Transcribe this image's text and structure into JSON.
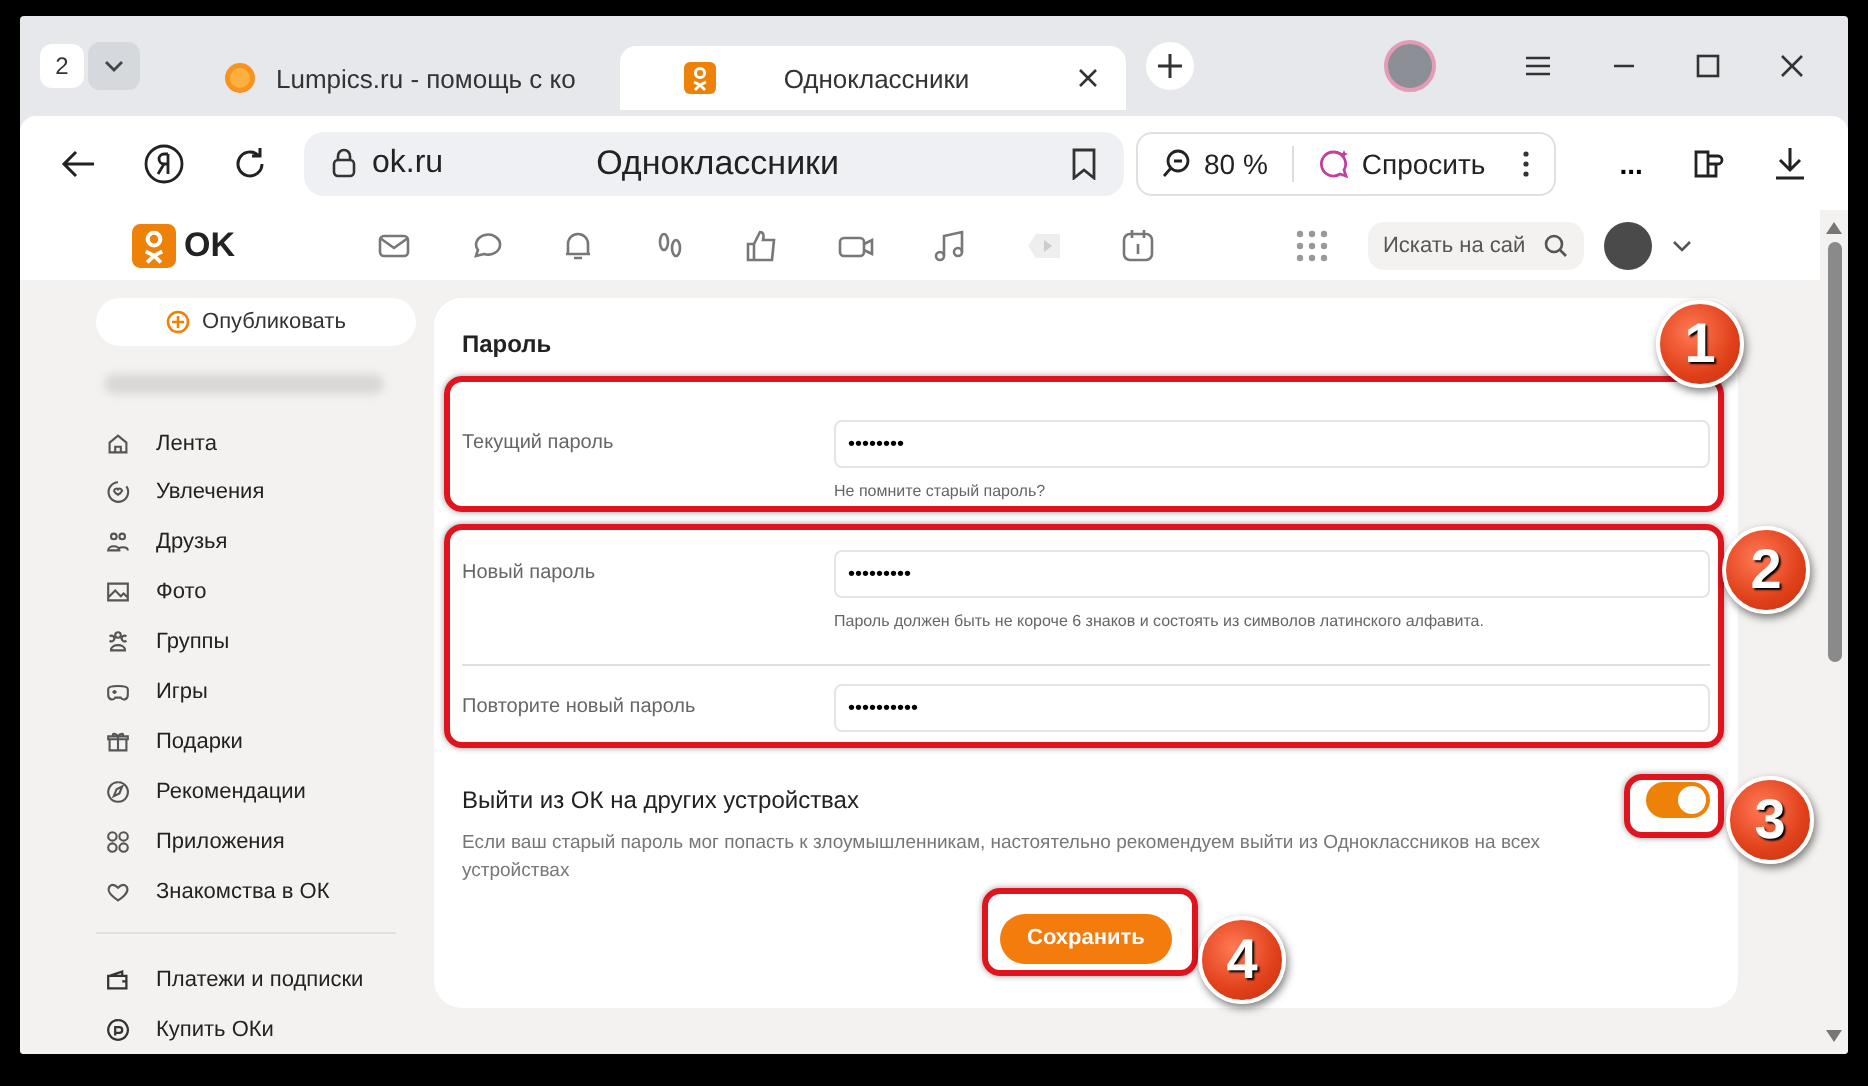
{
  "browser": {
    "tab_count": "2",
    "tabs": [
      {
        "title": "Lumpics.ru - помощь с ко",
        "selected": false
      },
      {
        "title": "Одноклассники",
        "selected": true
      }
    ],
    "url": "ok.ru",
    "page_title": "Одноклассники",
    "zoom": "80 %",
    "ask": "Спросить",
    "more": "..."
  },
  "site_header": {
    "logo": "OK",
    "search": {
      "placeholder": "Искать на сай"
    }
  },
  "sidebar": {
    "publish": "Опубликовать",
    "items": [
      {
        "label": "Лента"
      },
      {
        "label": "Увлечения"
      },
      {
        "label": "Друзья"
      },
      {
        "label": "Фото"
      },
      {
        "label": "Группы"
      },
      {
        "label": "Игры"
      },
      {
        "label": "Подарки"
      },
      {
        "label": "Рекомендации"
      },
      {
        "label": "Приложения"
      },
      {
        "label": "Знакомства в ОК"
      }
    ],
    "bottom_items": [
      {
        "label": "Платежи и подписки"
      },
      {
        "label": "Купить ОКи"
      }
    ]
  },
  "form": {
    "title": "Пароль",
    "fields": [
      {
        "label": "Текущий пароль",
        "value": "••••••••",
        "hint": "Не помните старый пароль?"
      },
      {
        "label": "Новый пароль",
        "value": "•••••••••",
        "hint": "Пароль должен быть не короче 6 знаков и состоять из символов латинского алфавита."
      },
      {
        "label": "Повторите новый пароль",
        "value": "••••••••••"
      }
    ],
    "logout": {
      "label": "Выйти из ОК на других устройствах",
      "on": true,
      "description": "Если ваш старый пароль мог попасть к злоумышленникам, настоятельно рекомендуем выйти из Одноклассников на всех устройствах"
    },
    "save": "Сохранить"
  },
  "annotations": [
    {
      "label": "1"
    },
    {
      "label": "2"
    },
    {
      "label": "3"
    },
    {
      "label": "4"
    }
  ]
}
